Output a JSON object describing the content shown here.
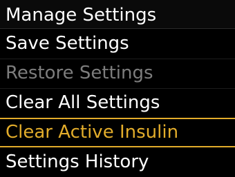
{
  "header": {
    "title": "Manage Settings"
  },
  "menu": {
    "items": [
      {
        "label": "Save Settings",
        "state": "enabled"
      },
      {
        "label": "Restore Settings",
        "state": "disabled"
      },
      {
        "label": "Clear All Settings",
        "state": "enabled"
      },
      {
        "label": "Clear Active Insulin",
        "state": "selected"
      },
      {
        "label": "Settings History",
        "state": "enabled"
      }
    ]
  },
  "colors": {
    "background": "#000000",
    "text": "#ffffff",
    "disabled_text": "#7d7d7d",
    "selection_accent": "#e3ad2b"
  }
}
